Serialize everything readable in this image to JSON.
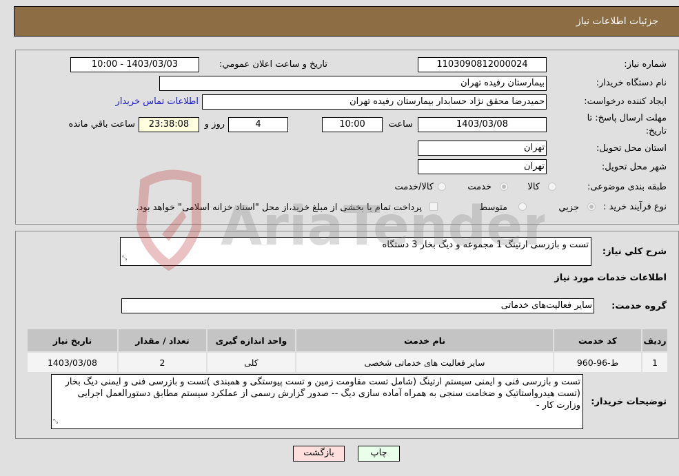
{
  "header": {
    "title": "جزئیات اطلاعات نیاز"
  },
  "form": {
    "need_number": {
      "label": "شماره نیاز:",
      "value": "1103090812000024"
    },
    "announce_datetime": {
      "label": "تاریخ و ساعت اعلان عمومي:",
      "value": "1403/03/03 - 10:00"
    },
    "buyer_org": {
      "label": "نام دستگاه خریدار:",
      "value": "بیمارستان رفیده تهران"
    },
    "requester": {
      "label": "ایجاد کننده درخواست:",
      "value": "حمیدرضا  محقق نژاد حسابدار بیمارستان رفیده تهران"
    },
    "buyer_contact_link": "اطلاعات تماس خریدار",
    "deadline": {
      "label_line1": "مهلت ارسال پاسخ: تا",
      "label_line2": "تاریخ:",
      "date": "1403/03/08",
      "time_label": "ساعت",
      "time": "10:00",
      "days": "4",
      "days_label": "روز و",
      "remaining": "23:38:08",
      "remaining_label": "ساعت باقي مانده"
    },
    "province": {
      "label": "استان محل تحویل:",
      "value": "تهران"
    },
    "city": {
      "label": "شهر محل تحویل:",
      "value": "تهران"
    },
    "category": {
      "label": "طبقه بندی موضوعی:",
      "options": [
        {
          "label": "کالا",
          "selected": false
        },
        {
          "label": "خدمت",
          "selected": true
        },
        {
          "label": "کالا/خدمت",
          "selected": false
        }
      ]
    },
    "process_type": {
      "label": "نوع فرآیند خرید :",
      "options": [
        {
          "label": "جزيي",
          "selected": true
        },
        {
          "label": "متوسط",
          "selected": false
        }
      ],
      "treasury_note": "پرداخت تمام یا بخشی از مبلغ خرید،از محل \"اسناد خزانه اسلامی\" خواهد بود.",
      "treasury_checked": false
    }
  },
  "details": {
    "summary_label": "شرح كلي نياز:",
    "summary_value": "تست و بازرسی ارتینگ 1 مجموعه  و دیگ بخار 3 دستگاه",
    "services_heading": "اطلاعات خدمات مورد نیاز",
    "service_group_label": "گروه خدمت:",
    "service_group_value": "سایر فعالیت‌های خدماتی",
    "table": {
      "columns": [
        "ردیف",
        "کد خدمت",
        "نام خدمت",
        "واحد اندازه گیری",
        "تعداد / مقدار",
        "تاریخ نیاز"
      ],
      "rows": [
        [
          "1",
          "ط-96-960",
          "سایر فعالیت های خدماتی شخصی",
          "کلی",
          "2",
          "1403/03/08"
        ]
      ]
    },
    "buyer_notes_label": "توضیحات خریدار:",
    "buyer_notes_value": "تست و بازرسی فنی و ایمنی سیستم ارتینگ (شامل تست مقاومت زمین و تست پیوستگی و همبندی )تست و بازرسی فنی و ایمنی دیگ بخار (تست هیدرواستاتیک و ضخامت سنجی به همراه آماده سازی دیگ -- صدور گزارش رسمی از عملکرد سیستم مطابق دستورالعمل اجرایی وزارت کار -"
  },
  "buttons": {
    "print": "چاپ",
    "back": "بازگشت"
  },
  "watermark": {
    "text": "AriaTender.neT"
  },
  "colors": {
    "header_bg": "#8c6d44",
    "link": "#1a1acc",
    "print_bg": "#eaffea",
    "back_bg": "#ffdede",
    "remaining_bg": "#ffffe0"
  }
}
